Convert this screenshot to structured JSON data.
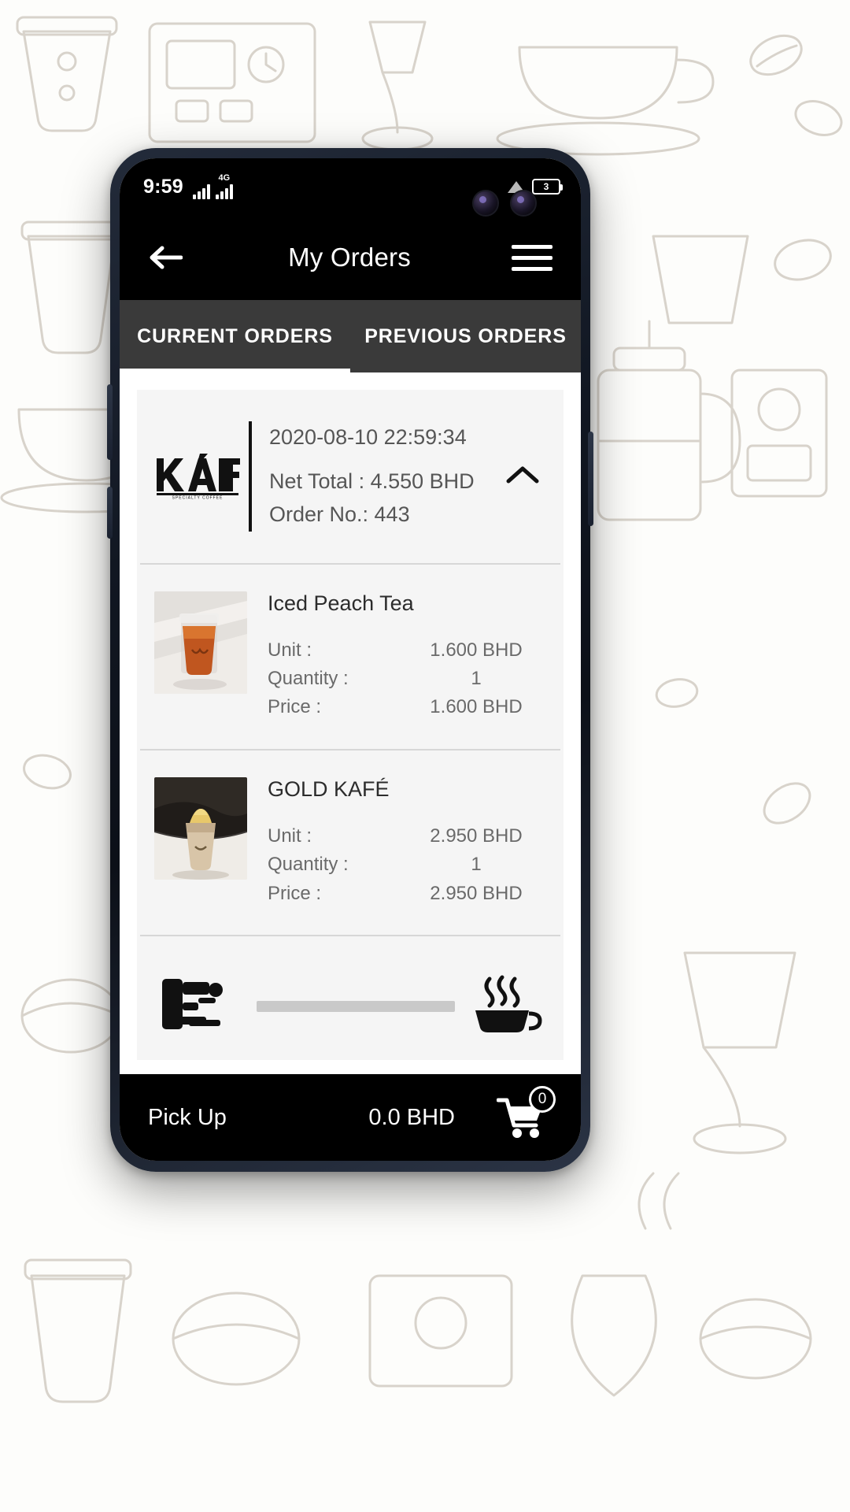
{
  "background": {
    "pattern_name": "coffee-doodles"
  },
  "status_bar": {
    "time": "9:59",
    "network_type": "4G",
    "battery_level": "3",
    "signal_icon": "signal-bars-icon",
    "wifi_icon": "wifi-icon",
    "battery_icon": "battery-icon"
  },
  "app_bar": {
    "title": "My Orders",
    "back_icon": "arrow-left-icon",
    "menu_icon": "hamburger-menu-icon"
  },
  "tabs": [
    {
      "label": "CURRENT ORDERS",
      "active": true
    },
    {
      "label": "PREVIOUS ORDERS",
      "active": false
    }
  ],
  "order": {
    "brand": "KAFÉ",
    "brand_sub": "SPECIALTY COFFEE",
    "datetime": "2020-08-10 22:59:34",
    "net_total": "Net Total : 4.550 BHD",
    "order_no": "Order No.: 443",
    "collapse_icon": "chevron-up-icon",
    "items": [
      {
        "name": "Iced Peach Tea",
        "thumb": "iced-tea-photo",
        "unit_label": "Unit :",
        "unit_value": "1.600 BHD",
        "quantity_label": "Quantity :",
        "quantity_value": "1",
        "price_label": "Price :",
        "price_value": "1.600 BHD"
      },
      {
        "name": "GOLD KAFÉ",
        "thumb": "gold-kafe-photo",
        "unit_label": "Unit :",
        "unit_value": "2.950 BHD",
        "quantity_label": "Quantity :",
        "quantity_value": "1",
        "price_label": "Price :",
        "price_value": "2.950 BHD"
      }
    ]
  },
  "promo": {
    "machine_icon": "espresso-machine-icon",
    "cup_icon": "coffee-cup-icon"
  },
  "bottom_bar": {
    "mode_label": "Pick Up",
    "total": "0.0 BHD",
    "cart_icon": "shopping-cart-icon",
    "cart_count": "0"
  },
  "colors": {
    "app_bar_bg": "#000000",
    "tab_bar_bg": "#3a3a3a",
    "card_bg": "#f5f5f5",
    "text_muted": "#6a6a6a",
    "accent": "#ffffff"
  }
}
